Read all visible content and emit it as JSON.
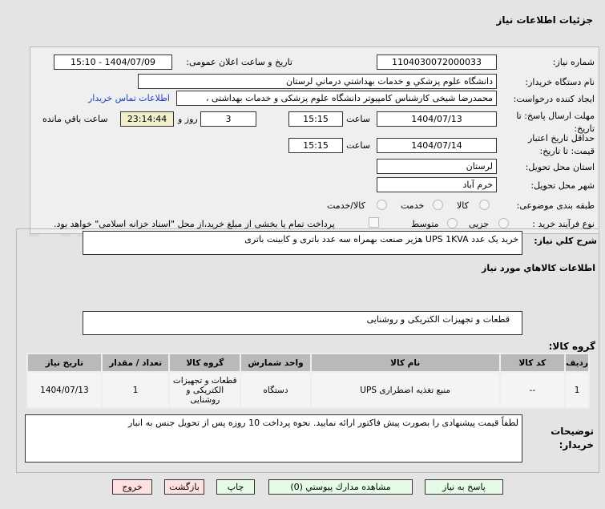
{
  "header": {
    "title": "جزئیات اطلاعات نیاز"
  },
  "watermark": "AriaTender.net",
  "form": {
    "need_number_label": "شماره نیاز:",
    "need_number": "1104030072000033",
    "announce_label": "تاریخ و ساعت اعلان عمومی:",
    "announce_value": "1404/07/09 - 15:10",
    "buyer_label": "نام دستگاه خریدار:",
    "buyer_value": "دانشگاه علوم پزشكي و خدمات بهداشتي درماني لرستان",
    "creator_label": "ایجاد کننده درخواست:",
    "creator_value": "محمدرضا شیخی کارشناس کامپیوتر دانشگاه علوم پزشکی و خدمات بهداشتی ،",
    "contact_link": "اطلاعات تماس خریدار",
    "deadline_label": "مهلت ارسال پاسخ: تا تاریخ:",
    "deadline_date": "1404/07/13",
    "time_label": "ساعت",
    "deadline_time": "15:15",
    "days": "3",
    "days_label": "روز و",
    "remaining": "23:14:44",
    "remaining_label": "ساعت باقي مانده",
    "validity_label": "حداقل تاریخ اعتبار قیمت: تا تاریخ:",
    "validity_date": "1404/07/14",
    "validity_time": "15:15",
    "province_label": "استان محل تحویل:",
    "province": "لرستان",
    "city_label": "شهر محل تحویل:",
    "city": "خرم آباد",
    "category_label": "طبقه بندی موضوعی:",
    "category_options": [
      "کالا",
      "خدمت",
      "کالا/خدمت"
    ],
    "process_label": "نوع فرآیند خرید :",
    "process_options": [
      "جزیی",
      "متوسط"
    ],
    "payment_note": "پرداخت تمام یا بخشی از مبلغ خرید،از محل \"اسناد خزانه اسلامی\" خواهد بود."
  },
  "description": {
    "label": "شرح کلي نياز:",
    "value": "خرید یک عدد UPS 1KVA هژیر صنعت بهمراه سه عدد باتری و کابینت باتری"
  },
  "goods": {
    "section_title": "اطلاعات کالاهاي مورد نياز",
    "group_label": "گروه کالا:",
    "group_value": "قطعات و تجهیزات الکتریکی و روشنایی",
    "columns": [
      "ردیف",
      "کد کالا",
      "نام کالا",
      "واحد شمارش",
      "گروه کالا",
      "تعداد / مقدار",
      "تاریخ نیاز"
    ],
    "rows": [
      [
        "1",
        "--",
        "منبع تغذیه اضطراری UPS",
        "دستگاه",
        "قطعات و تجهیزات الکتریکی و روشنایی",
        "1",
        "1404/07/13"
      ]
    ]
  },
  "notes": {
    "label": "توضیحات خریدار:",
    "value": "لطفاً قیمت پیشنهادی را بصورت پیش فاکتور ارائه نمایید. نحوه پرداخت 10 روزه پس از تحویل جنس به انبار"
  },
  "buttons": {
    "reply": "پاسخ به نیاز",
    "attachments": "مشاهده مدارك پیوستي (0)",
    "print": "چاپ",
    "back": "بازگشت",
    "exit": "خروج"
  }
}
